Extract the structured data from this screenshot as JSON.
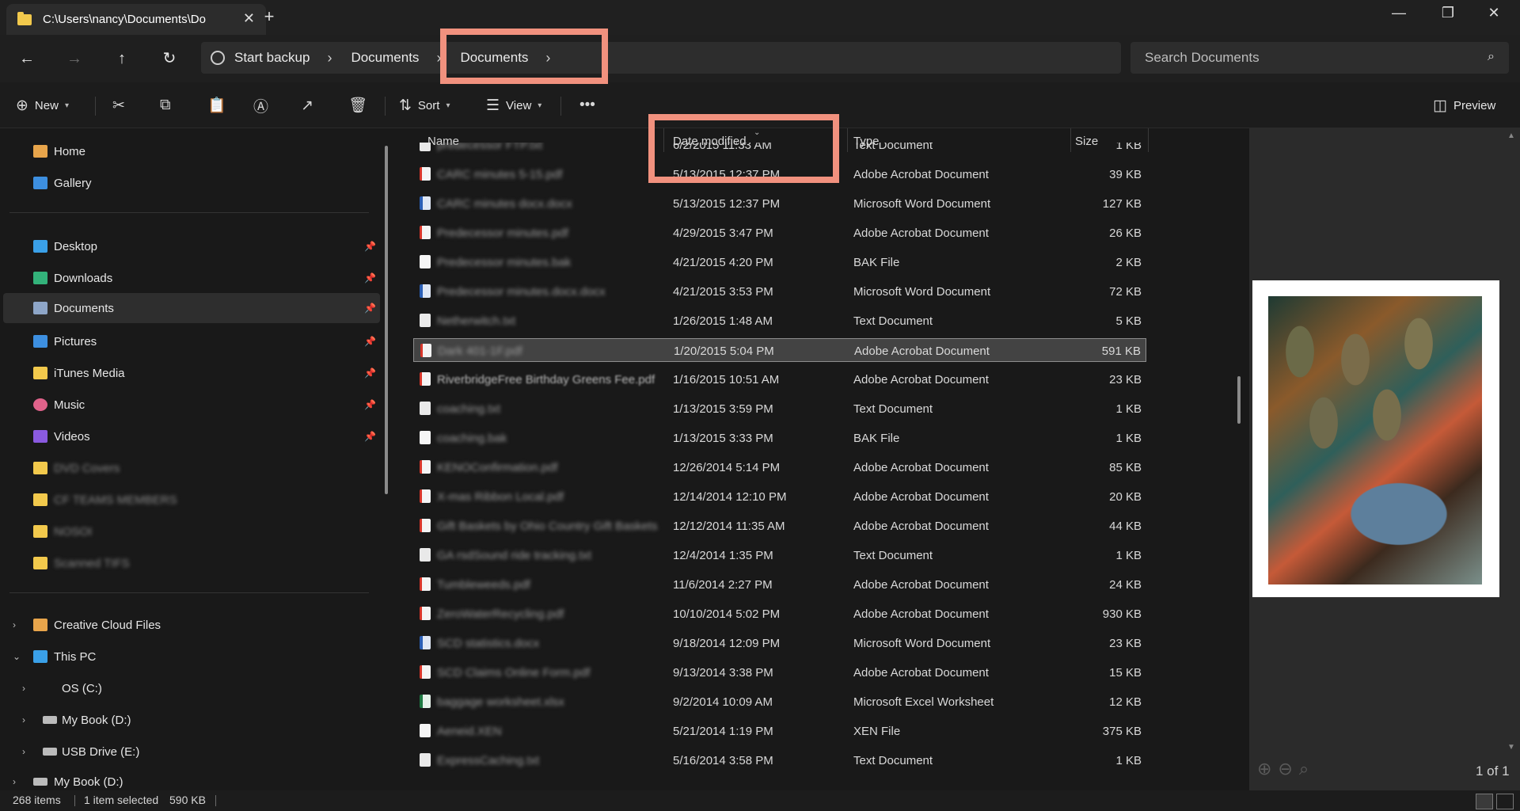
{
  "window": {
    "tab_title": "C:\\Users\\nancy\\Documents\\Do",
    "tab_close": "✕",
    "new_tab": "+",
    "minimize": "—",
    "restore": "❐",
    "close": "✕"
  },
  "nav": {
    "back": "←",
    "forward": "→",
    "up": "↑",
    "refresh": "↻",
    "breadcrumbs": [
      "Start backup",
      "Documents",
      "Documents"
    ],
    "sep": "›",
    "search_placeholder": "Search Documents",
    "search_icon": "⌕"
  },
  "commands": {
    "new": "New",
    "sort": "Sort",
    "view": "View",
    "more": "•••",
    "preview": "Preview"
  },
  "sidebar": {
    "quick": [
      {
        "label": "Home",
        "icon": "home-icon",
        "color": "#e8a54b"
      },
      {
        "label": "Gallery",
        "icon": "gallery-icon",
        "color": "#3d8fe0"
      }
    ],
    "pinned": [
      {
        "label": "Desktop",
        "icon": "desktop-icon",
        "color": "#3aa0e8",
        "pinned": true
      },
      {
        "label": "Downloads",
        "icon": "downloads-icon",
        "color": "#33b27a",
        "pinned": true
      },
      {
        "label": "Documents",
        "icon": "documents-icon",
        "color": "#8ea6c8",
        "pinned": true,
        "selected": true
      },
      {
        "label": "Pictures",
        "icon": "pictures-icon",
        "color": "#3d8fe0",
        "pinned": true
      },
      {
        "label": "iTunes Media",
        "icon": "folder-icon",
        "color": "#f2c94c",
        "pinned": true
      },
      {
        "label": "Music",
        "icon": "music-icon",
        "color": "#e0628a",
        "pinned": true
      },
      {
        "label": "Videos",
        "icon": "videos-icon",
        "color": "#8a5ae0",
        "pinned": true
      }
    ],
    "folders": [
      "DVD Covers",
      "CF TEAMS MEMBERS",
      "NOSOI",
      "Scanned TIFS"
    ],
    "tree": [
      {
        "label": "Creative Cloud Files",
        "icon": "creative-cloud-icon",
        "color": "#e8a54b",
        "expander": "›"
      },
      {
        "label": "This PC",
        "icon": "pc-icon",
        "color": "#3aa0e8",
        "expander": "⌄"
      },
      {
        "label": "OS (C:)",
        "icon": "drive-icon",
        "color": "#9ab",
        "expander": "›",
        "indent": true
      },
      {
        "label": "My Book (D:)",
        "icon": "drive-icon",
        "color": "#bbb",
        "expander": "›",
        "indent": true
      },
      {
        "label": "USB Drive (E:)",
        "icon": "drive-icon",
        "color": "#bbb",
        "expander": "›",
        "indent": true
      },
      {
        "label": "My Book (D:)",
        "icon": "drive-icon",
        "color": "#bbb",
        "expander": "›",
        "indent": false
      }
    ]
  },
  "columns": {
    "name": "Name",
    "date": "Date modified",
    "type": "Type",
    "size": "Size"
  },
  "files": [
    {
      "name": "predecessor FTP.txt",
      "date": "6/2/2015 11:33 AM",
      "type": "Text Document",
      "size": "1 KB",
      "icon": "txt"
    },
    {
      "name": "CARC minutes 5-15.pdf",
      "date": "5/13/2015 12:37 PM",
      "type": "Adobe Acrobat Document",
      "size": "39 KB",
      "icon": "pdf"
    },
    {
      "name": "CARC minutes docx.docx",
      "date": "5/13/2015 12:37 PM",
      "type": "Microsoft Word Document",
      "size": "127 KB",
      "icon": "doc"
    },
    {
      "name": "Predecessor minutes.pdf",
      "date": "4/29/2015 3:47 PM",
      "type": "Adobe Acrobat Document",
      "size": "26 KB",
      "icon": "pdf"
    },
    {
      "name": "Predecessor minutes.bak",
      "date": "4/21/2015 4:20 PM",
      "type": "BAK File",
      "size": "2 KB",
      "icon": "bak"
    },
    {
      "name": "Predecessor minutes.docx.docx",
      "date": "4/21/2015 3:53 PM",
      "type": "Microsoft Word Document",
      "size": "72 KB",
      "icon": "doc"
    },
    {
      "name": "Netherwitch.txt",
      "date": "1/26/2015 1:48 AM",
      "type": "Text Document",
      "size": "5 KB",
      "icon": "txt"
    },
    {
      "name": "Dark 401-1F.pdf",
      "date": "1/20/2015 5:04 PM",
      "type": "Adobe Acrobat Document",
      "size": "591 KB",
      "icon": "pdf",
      "selected": true
    },
    {
      "name": "RiverbridgeFree Birthday Greens Fee.pdf",
      "date": "1/16/2015 10:51 AM",
      "type": "Adobe Acrobat Document",
      "size": "23 KB",
      "icon": "pdf",
      "clear": true
    },
    {
      "name": "coaching.txt",
      "date": "1/13/2015 3:59 PM",
      "type": "Text Document",
      "size": "1 KB",
      "icon": "txt"
    },
    {
      "name": "coaching.bak",
      "date": "1/13/2015 3:33 PM",
      "type": "BAK File",
      "size": "1 KB",
      "icon": "bak"
    },
    {
      "name": "KENOConfirmation.pdf",
      "date": "12/26/2014 5:14 PM",
      "type": "Adobe Acrobat Document",
      "size": "85 KB",
      "icon": "pdf"
    },
    {
      "name": "X-mas Ribbon Local.pdf",
      "date": "12/14/2014 12:10 PM",
      "type": "Adobe Acrobat Document",
      "size": "20 KB",
      "icon": "pdf"
    },
    {
      "name": "Gift Baskets by Ohio Country Gift Baskets...",
      "date": "12/12/2014 11:35 AM",
      "type": "Adobe Acrobat Document",
      "size": "44 KB",
      "icon": "pdf"
    },
    {
      "name": "GA rsdSound ride tracking.txt",
      "date": "12/4/2014 1:35 PM",
      "type": "Text Document",
      "size": "1 KB",
      "icon": "txt"
    },
    {
      "name": "Tumbleweeds.pdf",
      "date": "11/6/2014 2:27 PM",
      "type": "Adobe Acrobat Document",
      "size": "24 KB",
      "icon": "pdf"
    },
    {
      "name": "ZeroWaterRecycling.pdf",
      "date": "10/10/2014 5:02 PM",
      "type": "Adobe Acrobat Document",
      "size": "930 KB",
      "icon": "pdf"
    },
    {
      "name": "SCD statistics.docx",
      "date": "9/18/2014 12:09 PM",
      "type": "Microsoft Word Document",
      "size": "23 KB",
      "icon": "doc"
    },
    {
      "name": "SCD Claims Online Form.pdf",
      "date": "9/13/2014 3:38 PM",
      "type": "Adobe Acrobat Document",
      "size": "15 KB",
      "icon": "pdf"
    },
    {
      "name": "baggage worksheet.xlsx",
      "date": "9/2/2014 10:09 AM",
      "type": "Microsoft Excel Worksheet",
      "size": "12 KB",
      "icon": "xls"
    },
    {
      "name": "Aeneid.XEN",
      "date": "5/21/2014 1:19 PM",
      "type": "XEN File",
      "size": "375 KB",
      "icon": "xen"
    },
    {
      "name": "ExpressCaching.txt",
      "date": "5/16/2014 3:58 PM",
      "type": "Text Document",
      "size": "1 KB",
      "icon": "txt"
    }
  ],
  "preview": {
    "page_indicator": "1 of 1",
    "tools": "⊕⊖⌕"
  },
  "status": {
    "items": "268 items",
    "selected": "1 item selected",
    "size": "590 KB"
  }
}
